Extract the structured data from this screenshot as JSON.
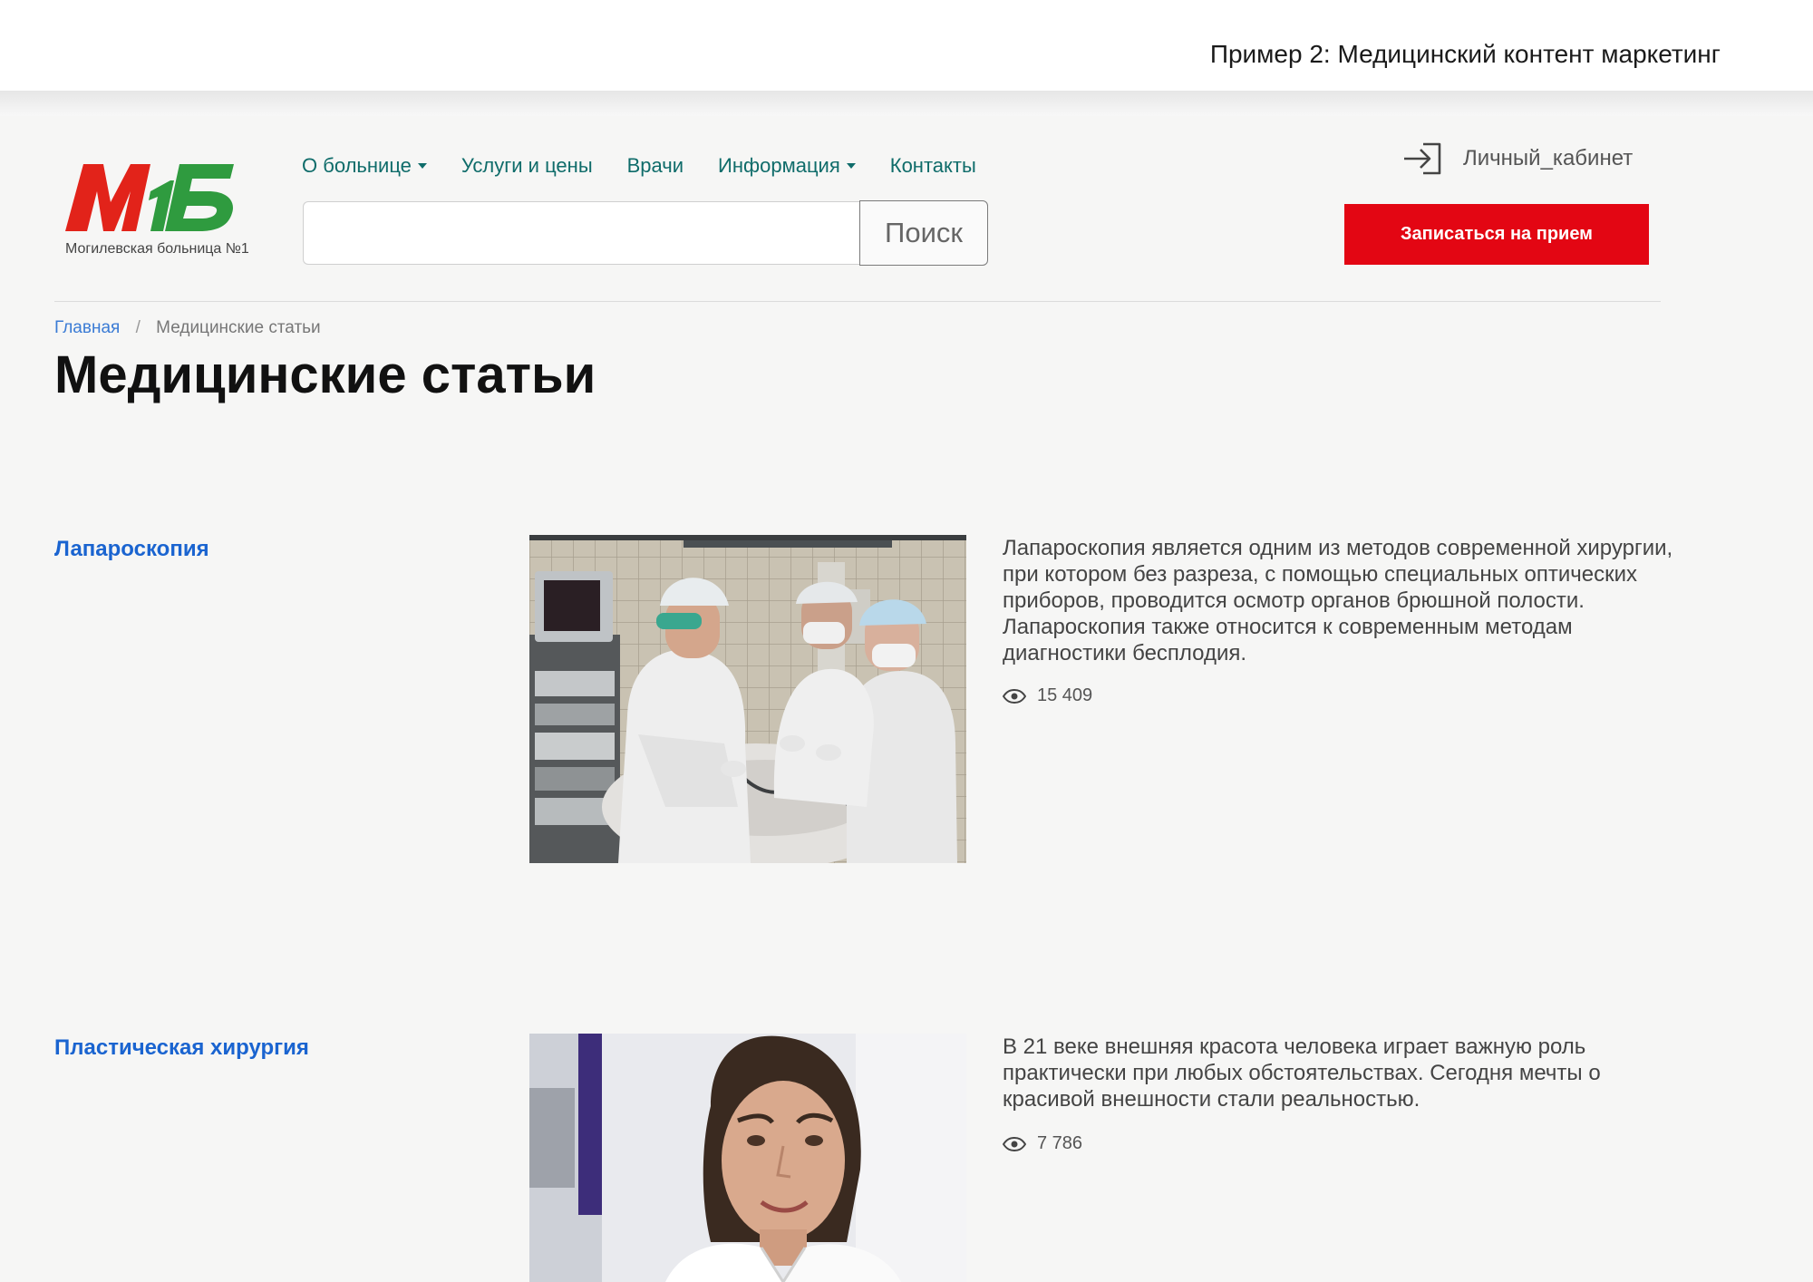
{
  "slide_caption": "Пример 2: Медицинский контент маркетинг",
  "logo": {
    "caption": "Могилевская больница №1",
    "colors": {
      "red": "#e2231a",
      "green": "#2f9b3f"
    }
  },
  "nav": {
    "items": [
      {
        "label": "О больнице",
        "has_dropdown": true
      },
      {
        "label": "Услуги и цены",
        "has_dropdown": false
      },
      {
        "label": "Врачи",
        "has_dropdown": false
      },
      {
        "label": "Информация",
        "has_dropdown": true
      },
      {
        "label": "Контакты",
        "has_dropdown": false
      }
    ],
    "color": "#0f6c6a"
  },
  "search": {
    "value": "",
    "placeholder": "",
    "button_label": "Поиск"
  },
  "account": {
    "label": "Личный_кабинет",
    "icon": "login-icon"
  },
  "cta": {
    "label": "Записаться на прием",
    "color": "#e30613"
  },
  "breadcrumb": {
    "home": "Главная",
    "separator": "/",
    "current": "Медицинские статьи"
  },
  "page_title": "Медицинские статьи",
  "articles": [
    {
      "title": "Лапароскопия",
      "text": "Лапароскопия является одним из методов современной хирургии, при котором без разреза, с помощью специальных оптических приборов, проводится осмотр органов брюшной полости. Лапароскопия также относится к современным методам диагностики бесплодия.",
      "views": "15 409",
      "image": "surgery-team-photo"
    },
    {
      "title": "Пластическая хирургия",
      "text": "В 21 веке внешняя красота человека играет важную роль практически при любых обстоятельствах. Сегодня мечты о красивой внешности стали реальностью.",
      "views": "7 786",
      "image": "doctor-portrait-photo"
    }
  ],
  "colors": {
    "link": "#1a64d0",
    "background": "#f6f6f5"
  }
}
